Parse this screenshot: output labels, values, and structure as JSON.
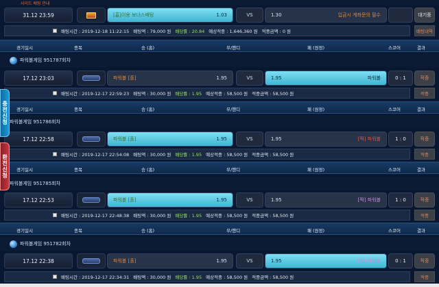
{
  "top_strip": {
    "text": "사이드 배팅 안내"
  },
  "headers": {
    "datetime": "경기일시",
    "sport": "종목",
    "home": "승 (홈)",
    "draw": "무/핸디",
    "away": "패 (원정)",
    "score": "스코어",
    "result": "결과"
  },
  "side_tabs": {
    "charge": "충전신청",
    "exchange": "환전신청"
  },
  "bets": [
    {
      "datetime": "31.12 23:59",
      "home_team": "[홈]이용 보너스배팅",
      "home_odds": "1.03",
      "vs": "VS",
      "away_odds": "1.30",
      "away_team": "입금시 계좌문의 필수",
      "score": "",
      "result": "대기중",
      "info": {
        "bet_time": "배팅시간 : 2019-12-18 11:22:15",
        "amount": "배팅액 : 79,000 원",
        "odds": "배당률 : 20.84",
        "expected": "예상적중 : 1,646,360 원",
        "won": "적중금액 : 0 원",
        "button": "배팅내역"
      }
    },
    {
      "game_title": "파워볼게임 951787회차",
      "datetime": "17.12 23:03",
      "home_team": "파워볼 [홀]",
      "home_odds": "1.95",
      "vs": "VS",
      "away_odds": "1.95",
      "away_team": "파워볼",
      "score": "0 : 1",
      "result": "적중",
      "info": {
        "bet_time": "배팅시간 : 2019-12-17 22:59:23",
        "amount": "배팅액 : 30,000 원",
        "odds": "배당률 : 1.95",
        "expected": "예상적중 : 58,500 원",
        "won": "적중금액 : 58,500 원",
        "button": "적중"
      }
    },
    {
      "game_title": "파워볼게임 951786회차",
      "datetime": "17.12 22:58",
      "home_team": "파워볼 [홀]",
      "home_odds": "1.95",
      "vs": "VS",
      "away_odds": "1.95",
      "away_team": "[짝] 파워볼",
      "score": "1 : 0",
      "result": "적중",
      "info": {
        "bet_time": "배팅시간 : 2019-12-17 22:54:08",
        "amount": "배팅액 : 30,000 원",
        "odds": "배당률 : 1.95",
        "expected": "예상적중 : 58,500 원",
        "won": "적중금액 : 58,500 원",
        "button": "적중"
      }
    },
    {
      "game_title": "파워볼게임 951785회차",
      "datetime": "17.12 22:53",
      "home_team": "파워볼 [홀]",
      "home_odds": "1.95",
      "vs": "VS",
      "away_odds": "1.95",
      "away_team": "[짝] 파워볼",
      "score": "1 : 0",
      "result": "적중",
      "info": {
        "bet_time": "배팅시간 : 2019-12-17 22:48:38",
        "amount": "배팅액 : 30,000 원",
        "odds": "배당률 : 1.95",
        "expected": "예상적중 : 58,500 원",
        "won": "적중금액 : 58,500 원",
        "button": "적중"
      }
    },
    {
      "game_title": "파워볼게임 951782회차",
      "datetime": "17.12 22:38",
      "home_team": "파워볼 [홀]",
      "home_odds": "1.95",
      "vs": "VS",
      "away_odds": "1.95",
      "away_team": "[짝] 파워볼",
      "score": "0 : 1",
      "result": "적중",
      "info": {
        "bet_time": "배팅시간 : 2019-12-17 22:34:31",
        "amount": "배팅액 : 30,000 원",
        "odds": "배당률 : 1.95",
        "expected": "예상적중 : 58,500 원",
        "won": "적중금액 : 58,500 원",
        "button": "적중"
      }
    }
  ]
}
